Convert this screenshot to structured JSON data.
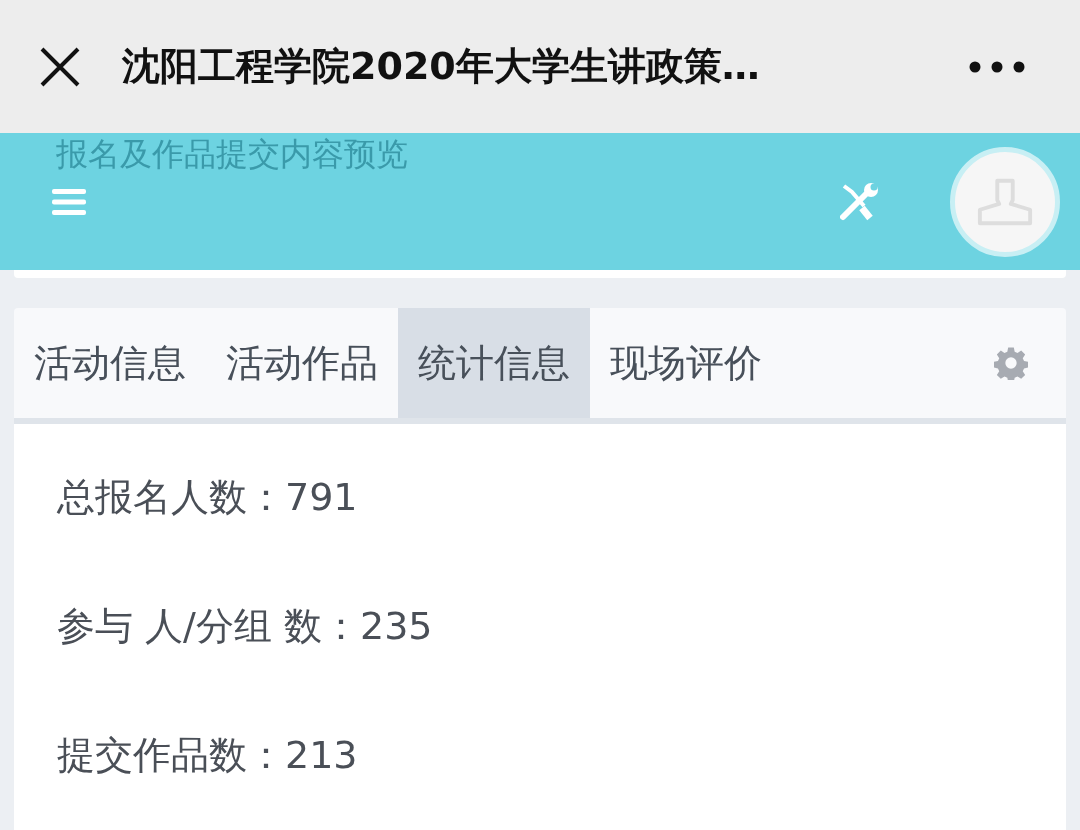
{
  "window": {
    "title": "沈阳工程学院2020年大学生讲政策…"
  },
  "header": {
    "faded_text": "报名及作品提交内容预览"
  },
  "tabs": [
    {
      "label": "活动信息",
      "selected": false
    },
    {
      "label": "活动作品",
      "selected": false
    },
    {
      "label": "统计信息",
      "selected": true
    },
    {
      "label": "现场评价",
      "selected": false
    }
  ],
  "stats": [
    "总报名人数：791",
    "参与 人/分组 数：235",
    "提交作品数：213"
  ]
}
